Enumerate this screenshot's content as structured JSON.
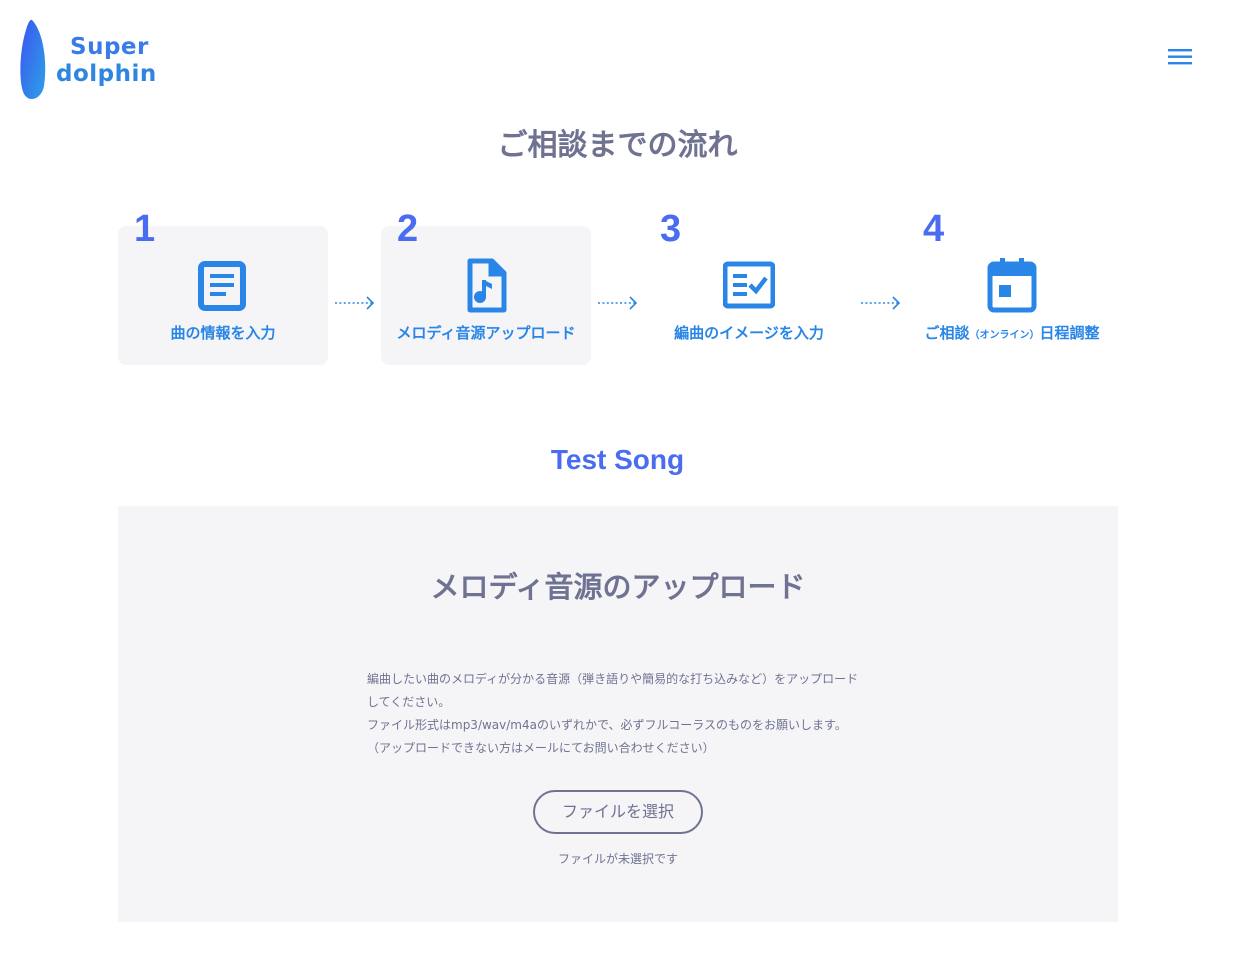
{
  "header": {
    "logo_line1": "Super",
    "logo_line2": "dolphin",
    "menu_icon": "hamburger-menu-icon"
  },
  "colors": {
    "accent": "#4a6cf0",
    "icon_blue": "#2a86e6",
    "text_gray": "#6f7391",
    "panel_bg": "#f5f5f8"
  },
  "flow": {
    "title": "ご相談までの流れ",
    "steps": [
      {
        "number": "1",
        "label": "曲の情報を入力",
        "icon": "document-list-icon",
        "active": true
      },
      {
        "number": "2",
        "label": "メロディ音源アップロード",
        "icon": "music-file-icon",
        "active": true
      },
      {
        "number": "3",
        "label": "編曲のイメージを入力",
        "icon": "checklist-icon",
        "active": false
      },
      {
        "number": "4",
        "label_main": "ご相談",
        "label_small": "（オンライン）",
        "label_end": "日程調整",
        "icon": "calendar-icon",
        "active": false
      }
    ]
  },
  "song": {
    "title": "Test Song"
  },
  "upload": {
    "title": "メロディ音源のアップロード",
    "description_lines": [
      "編曲したい曲のメロディが分かる音源（弾き語りや簡易的な打ち込みなど）をアップロード",
      "してください。",
      "ファイル形式はmp3/wav/m4aのいずれかで、必ずフルコーラスのものをお願いします。",
      "（アップロードできない方はメールにてお問い合わせください）"
    ],
    "button_label": "ファイルを選択",
    "file_status": "ファイルが未選択です"
  }
}
